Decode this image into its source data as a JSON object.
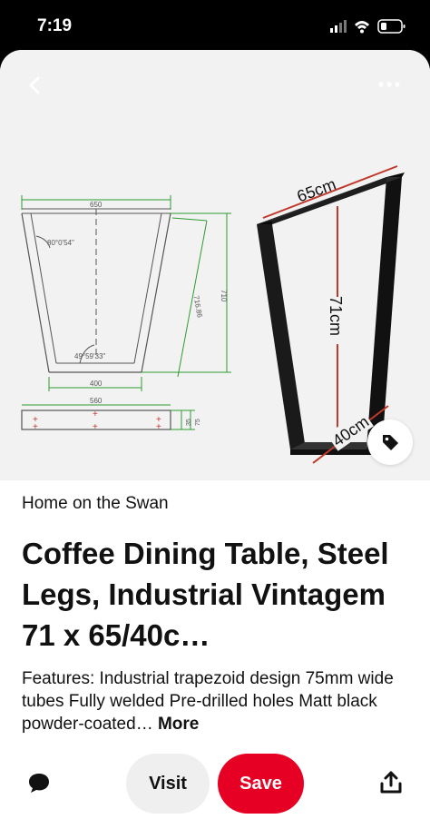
{
  "status_bar": {
    "time": "7:19"
  },
  "pin": {
    "source": "Home on the Swan",
    "title": "Coffee Dining Table, Steel Legs, Industrial Vintagem 71 x 65/40c…",
    "description": "Features: Industrial trapezoid design 75mm wide tubes Fully welded Pre-drilled holes Matt black powder-coated…",
    "more_label": "More"
  },
  "image": {
    "drawing": {
      "top_dim": "650",
      "angle_top": "80°0'54\"",
      "side_dim": "716.86",
      "height_dim": "710",
      "angle_bottom": "49°59'33\"",
      "bottom_dim": "400",
      "base_dim": "560",
      "small_dim_1": "35",
      "small_dim_2": "75"
    },
    "photo": {
      "width_label": "65cm",
      "height_label": "71cm",
      "bottom_label": "40cm"
    }
  },
  "actions": {
    "visit_label": "Visit",
    "save_label": "Save"
  },
  "colors": {
    "save": "#e60023",
    "visit_bg": "#efefef",
    "dimension_red": "#c0392b",
    "drawing_green": "#2e9b2e"
  }
}
